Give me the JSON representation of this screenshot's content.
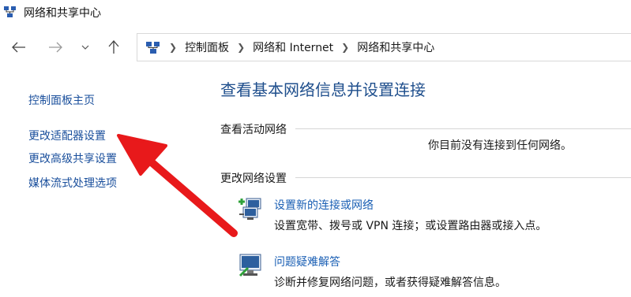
{
  "window": {
    "title": "网络和共享中心"
  },
  "breadcrumb": [
    "控制面板",
    "网络和 Internet",
    "网络和共享中心"
  ],
  "left_pane": {
    "home": "控制面板主页",
    "links": [
      "更改适配器设置",
      "更改高级共享设置",
      "媒体流式处理选项"
    ]
  },
  "main": {
    "title": "查看基本网络信息并设置连接",
    "active_networks_heading": "查看活动网络",
    "no_connection": "你目前没有连接到任何网络。",
    "change_settings_heading": "更改网络设置",
    "tasks": [
      {
        "link": "设置新的连接或网络",
        "desc": "设置宽带、拨号或 VPN 连接；或设置路由器或接入点。",
        "icon": "network-setup-icon"
      },
      {
        "link": "问题疑难解答",
        "desc": "诊断并修复网络问题，或者获得疑难解答信息。",
        "icon": "troubleshoot-icon"
      }
    ]
  },
  "colors": {
    "link": "#1a5fb4",
    "title": "#1e4e8c",
    "arrow": "#e8191b"
  }
}
